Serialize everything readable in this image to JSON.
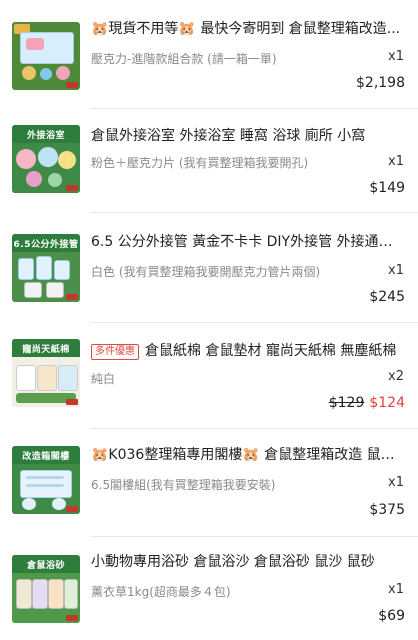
{
  "items": [
    {
      "thumb_label": "",
      "thumb_color": "#5aa0d8",
      "title_prefix_emoji": "🐹",
      "title": "現貨不用等🐹 最快今寄明到 倉鼠整理箱改造...",
      "promo_tag": "",
      "variant": "壓克力-進階款組合款 (請一箱一單)",
      "quantity": "x1",
      "original_price": "",
      "price": "$2,198"
    },
    {
      "thumb_label": "外接浴室",
      "thumb_color": "#2e7d3c",
      "title_prefix_emoji": "",
      "title": "倉鼠外接浴室 外接浴室 睡窩 浴球 廁所 小窩",
      "promo_tag": "",
      "variant": "粉色＋壓克力片 (我有買整理箱我要開孔)",
      "quantity": "x1",
      "original_price": "",
      "price": "$149"
    },
    {
      "thumb_label": "6.5公分外接管",
      "thumb_color": "#2e7d3c",
      "title_prefix_emoji": "",
      "title": "6.5 公分外接管 黃金不卡卡 DIY外接管 外接通道...",
      "promo_tag": "",
      "variant": "白色 (我有買整理箱我要開壓克力管片兩個)",
      "quantity": "x1",
      "original_price": "",
      "price": "$245"
    },
    {
      "thumb_label": "寵尚天紙棉",
      "thumb_color": "#2e7d3c",
      "title_prefix_emoji": "",
      "title": "倉鼠紙棉 倉鼠墊材 寵尚天紙棉 無塵紙棉",
      "promo_tag": "多件優惠",
      "variant": "純白",
      "quantity": "x2",
      "original_price": "$129",
      "price": "$124"
    },
    {
      "thumb_label": "改造箱閣樓",
      "thumb_color": "#2e7d3c",
      "title_prefix_emoji": "🐹",
      "title": "K036整理箱專用閣樓🐹 倉鼠整理箱改造 鼠籠...",
      "promo_tag": "",
      "variant": "6.5閣樓組(我有買整理箱我要安裝)",
      "quantity": "x1",
      "original_price": "",
      "price": "$375"
    },
    {
      "thumb_label": "倉鼠浴砂",
      "thumb_color": "#2e7d3c",
      "title_prefix_emoji": "",
      "title": "小動物專用浴砂 倉鼠浴沙 倉鼠浴砂 鼠沙 鼠砂",
      "promo_tag": "",
      "variant": "薰衣草1kg(超商最多４包)",
      "quantity": "x1",
      "original_price": "",
      "price": "$69"
    }
  ]
}
